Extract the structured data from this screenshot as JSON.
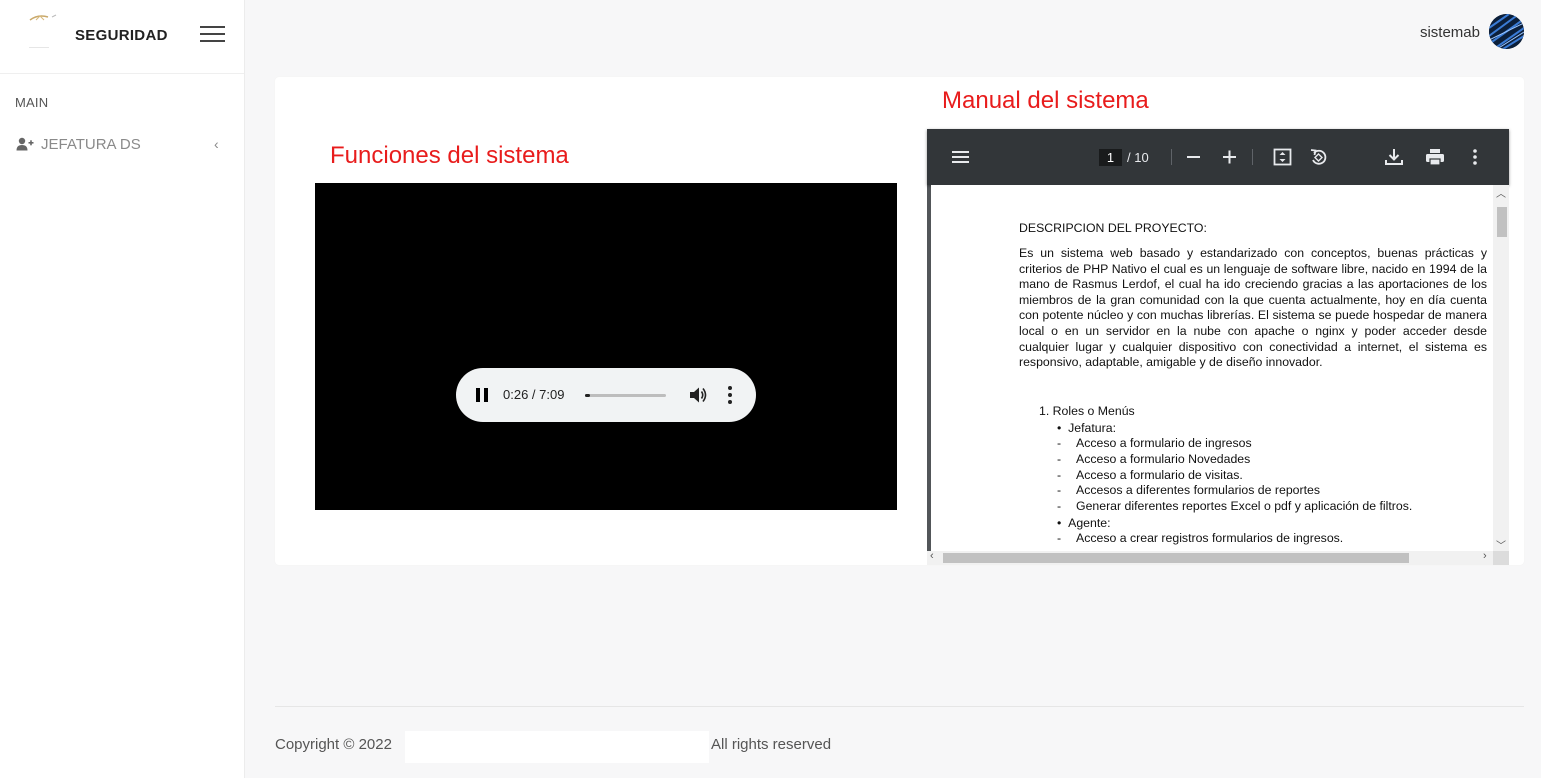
{
  "sidebar": {
    "brand": "SEGURIDAD",
    "section_title": "MAIN",
    "items": [
      {
        "label": "JEFATURA DS",
        "icon": "user-plus-icon",
        "chevron": "‹"
      }
    ]
  },
  "header": {
    "username": "sistemab",
    "avatar_icon": "avatar-image"
  },
  "main": {
    "left_title": "Funciones del sistema",
    "right_title": "Manual del sistema",
    "title_color": "#e81c1c",
    "video": {
      "time": "0:26 / 7:09",
      "progress": 0.061,
      "background": "#000000"
    },
    "pdf": {
      "page_current": "1",
      "page_total": "/ 10",
      "document": {
        "heading": "DESCRIPCION DEL PROYECTO:",
        "paragraph": "Es un sistema web basado y estandarizado con conceptos, buenas prácticas y criterios de PHP Nativo el cual es un lenguaje de software libre, nacido en 1994 de la mano de Rasmus Lerdof, el cual ha ido creciendo gracias a las aportaciones de los miembros de la gran comunidad con la que cuenta actualmente, hoy en día cuenta con potente núcleo y con muchas librerías. El sistema se puede hospedar de manera local o en un servidor en la nube con apache o nginx y poder acceder desde cualquier lugar y cualquier dispositivo con conectividad a internet, el sistema es responsivo, adaptable, amigable y de diseño innovador.",
        "list_title": "1.  Roles o Menús",
        "role1": "Jefatura:",
        "role1_items": [
          "Acceso a formulario de ingresos",
          "Acceso a formulario Novedades",
          "Acceso a formulario de visitas.",
          "Accesos a diferentes formularios de reportes",
          "Generar diferentes reportes Excel o pdf y aplicación de filtros."
        ],
        "role2": "Agente:",
        "role2_items": [
          "Acceso a crear registros formularios de ingresos."
        ]
      }
    }
  },
  "footer": {
    "copyright": "Copyright © 2022",
    "rights": "All rights reserved"
  }
}
